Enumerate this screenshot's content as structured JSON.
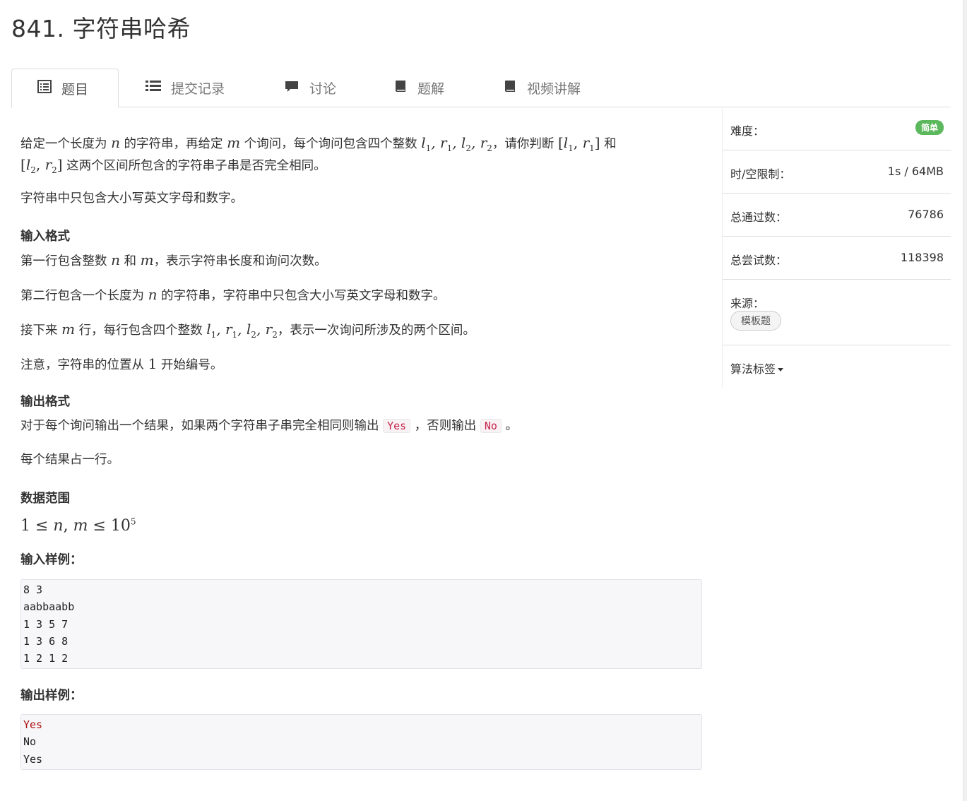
{
  "problem": {
    "title": "841. 字符串哈希"
  },
  "tabs": [
    {
      "label": "题目",
      "icon": "list-alt-icon"
    },
    {
      "label": "提交记录",
      "icon": "list-icon"
    },
    {
      "label": "讨论",
      "icon": "comment-icon"
    },
    {
      "label": "题解",
      "icon": "book-icon"
    },
    {
      "label": "视频讲解",
      "icon": "book-icon"
    }
  ],
  "description": {
    "p1_a": "给定一个长度为",
    "p1_b": "的字符串，再给定",
    "p1_c": "个询问，每个询问包含四个整数",
    "p1_d": "，请你判断",
    "p1_e": "和",
    "p1_f": "这两个区间所包含的字符串子串是否完全相同。",
    "p2": "字符串中只包含大小写英文字母和数字。"
  },
  "input_format": {
    "heading": "输入格式",
    "l1_a": "第一行包含整数",
    "l1_b": "和",
    "l1_c": "，表示字符串长度和询问次数。",
    "l2_a": "第二行包含一个长度为",
    "l2_b": "的字符串，字符串中只包含大小写英文字母和数字。",
    "l3_a": "接下来",
    "l3_b": "行，每行包含四个整数",
    "l3_c": "，表示一次询问所涉及的两个区间。",
    "l4_a": "注意，字符串的位置从",
    "l4_num": "1",
    "l4_b": "开始编号。"
  },
  "output_format": {
    "heading": "输出格式",
    "l1_a": "对于每个询问输出一个结果，如果两个字符串子串完全相同则输出",
    "yes": "Yes",
    "l1_b": "，否则输出",
    "no": "No",
    "l1_c": "。",
    "l2": "每个结果占一行。"
  },
  "range": {
    "heading": "数据范围",
    "base": "10",
    "exp": "5"
  },
  "sample_input": {
    "heading": "输入样例：",
    "lines": [
      "8 3",
      "aabbaabb",
      "1 3 5 7",
      "1 3 6 8",
      "1 2 1 2"
    ]
  },
  "sample_output": {
    "heading": "输出样例：",
    "lines": [
      "Yes",
      "No",
      "Yes"
    ]
  },
  "sidebar": {
    "difficulty_label": "难度：",
    "difficulty_value": "简单",
    "limit_label": "时/空限制：",
    "limit_value": "1s / 64MB",
    "passed_label": "总通过数：",
    "passed_value": "76786",
    "tried_label": "总尝试数：",
    "tried_value": "118398",
    "source_label": "来源：",
    "source_tag": "模板题",
    "algo_label": "算法标签"
  },
  "colors": {
    "badge": "#5cb85c",
    "code_text": "#c7254e",
    "border": "#dddddd"
  }
}
